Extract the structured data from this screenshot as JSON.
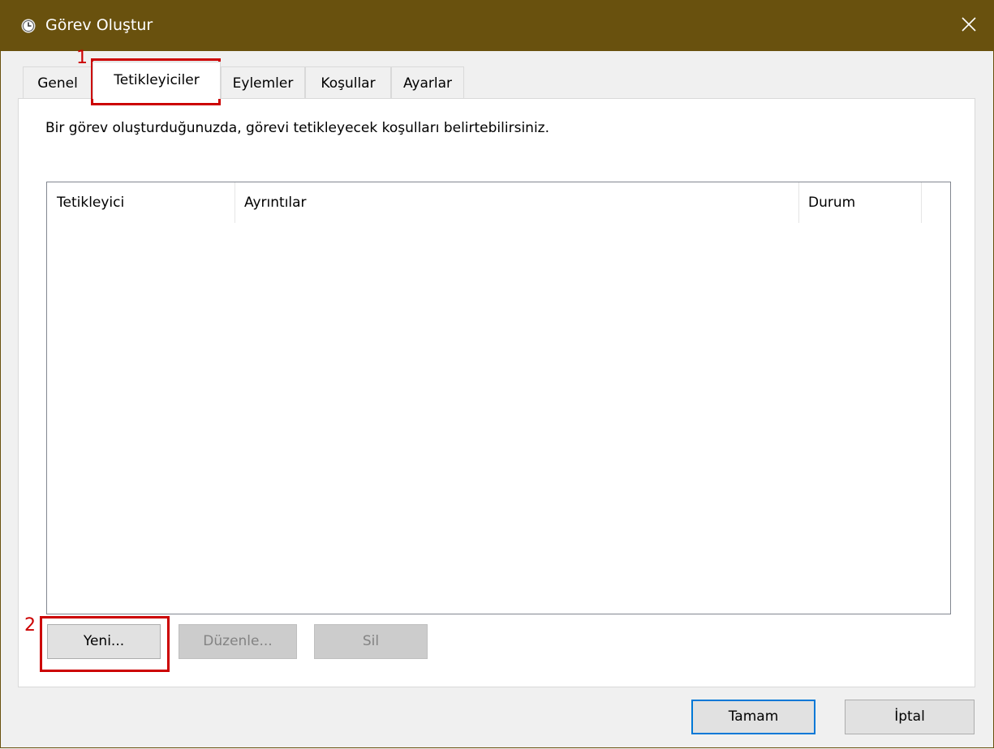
{
  "window": {
    "title": "Görev Oluştur",
    "icon": "clock-icon",
    "title_bar_color": "#69510e"
  },
  "tabs": [
    {
      "label": "Genel",
      "active": false
    },
    {
      "label": "Tetikleyiciler",
      "active": true
    },
    {
      "label": "Eylemler",
      "active": false
    },
    {
      "label": "Koşullar",
      "active": false
    },
    {
      "label": "Ayarlar",
      "active": false
    }
  ],
  "triggers_tab": {
    "description": "Bir görev oluşturduğunuzda, görevi tetikleyecek koşulları belirtebilirsiniz.",
    "columns": [
      "Tetikleyici",
      "Ayrıntılar",
      "Durum"
    ],
    "rows": [],
    "buttons": {
      "new": "Yeni...",
      "edit": "Düzenle...",
      "delete": "Sil"
    }
  },
  "footer": {
    "ok": "Tamam",
    "cancel": "İptal"
  },
  "annotations": {
    "marker_1": "1",
    "marker_2": "2",
    "color": "#cc0000"
  }
}
